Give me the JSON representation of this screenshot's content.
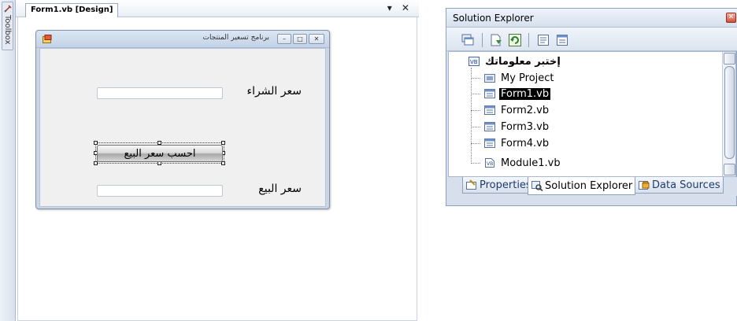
{
  "toolbox": {
    "label": "Toolbox"
  },
  "document": {
    "tab_title": "Form1.vb [Design]",
    "tab_controls": "▾ ✕"
  },
  "form": {
    "title": "برنامج تسعير المنتجات",
    "buttons": {
      "minimize": "–",
      "maximize": "□",
      "close": "✕"
    },
    "purchase_label": "سعر الشراء",
    "purchase_value": "",
    "calculate_button": "احسب سعر البيع",
    "sale_label": "سعر البيع",
    "sale_value": ""
  },
  "solution_explorer": {
    "title": "Solution Explorer",
    "close_glyph": "✕",
    "toolbar": [
      "show-all-files",
      "properties",
      "refresh",
      "view-code",
      "view-designer"
    ],
    "root": "إختبر معلوماتك",
    "items": [
      {
        "label": "My Project",
        "icon": "my-project-icon",
        "selected": false
      },
      {
        "label": "Form1.vb",
        "icon": "form-icon",
        "selected": true
      },
      {
        "label": "Form2.vb",
        "icon": "form-icon",
        "selected": false
      },
      {
        "label": "Form3.vb",
        "icon": "form-icon",
        "selected": false
      },
      {
        "label": "Form4.vb",
        "icon": "form-icon",
        "selected": false
      },
      {
        "label": "Module1.vb",
        "icon": "module-icon",
        "selected": false
      }
    ],
    "tabs": [
      {
        "label": "Properties",
        "active": false
      },
      {
        "label": "Solution Explorer",
        "active": true
      },
      {
        "label": "Data Sources",
        "active": false
      }
    ]
  },
  "colors": {
    "selection": "#000000",
    "panel_bg": "#d6dfeb",
    "form_client": "#f0f0f0"
  }
}
